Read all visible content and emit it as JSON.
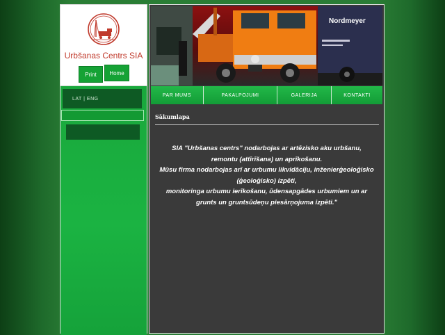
{
  "sidebar": {
    "brand": "Urbšanas Centrs SIA",
    "buttons": {
      "print": "Print",
      "home": "Home"
    },
    "lang": "LAT | ENG"
  },
  "nav": {
    "items": [
      "PAR MUMS",
      "PAKALPOJUMI",
      "GALERIJA",
      "KONTAKTI"
    ]
  },
  "banner": {
    "truck_brand": "Nordmeyer"
  },
  "content": {
    "title": "Sākumlapa",
    "lines": [
      "SIA \"Urbšanas centrs\" nodarbojas ar artēzisko aku urbšanu,",
      "remontu (attīrīšana) un aprīkošanu.",
      "Mūsu firma nodarbojas arī ar urbumu likvidāciju, inženierģeoloģisko",
      "(ģeoloģisko) izpēti,",
      "monitoringa urbumu ierīkošanu, ūdensapgādes urbumiem un ar",
      "grunts un gruntsūdeņu piesārņojuma izpēti.\""
    ]
  },
  "colors": {
    "accent_green": "#15a235",
    "dark_green": "#0e5a24",
    "brand_red": "#c0392b",
    "content_bg": "#3a3a3a"
  }
}
